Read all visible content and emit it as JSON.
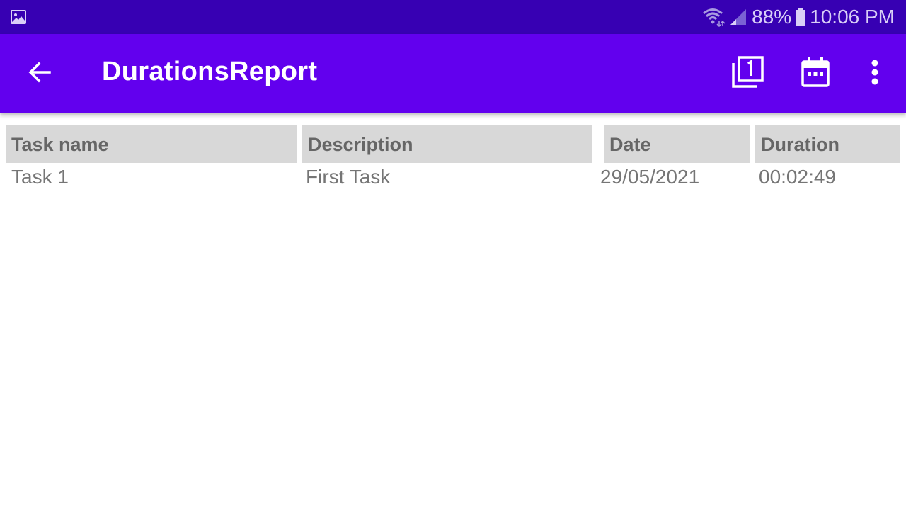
{
  "status_bar": {
    "battery_percent": "88%",
    "time": "10:06 PM",
    "icons": [
      "gallery-icon",
      "wifi-icon",
      "signal-icon",
      "battery-icon"
    ]
  },
  "app_bar": {
    "title": "DurationsReport",
    "actions": [
      "back-arrow-icon",
      "filter-one-icon",
      "calendar-icon",
      "more-vert-icon"
    ],
    "color": "#6200ee"
  },
  "table": {
    "headers": [
      "Task name",
      "Description",
      "Date",
      "Duration"
    ],
    "rows": [
      [
        "Task 1",
        "First Task",
        "29/05/2021",
        "00:02:49"
      ]
    ]
  }
}
